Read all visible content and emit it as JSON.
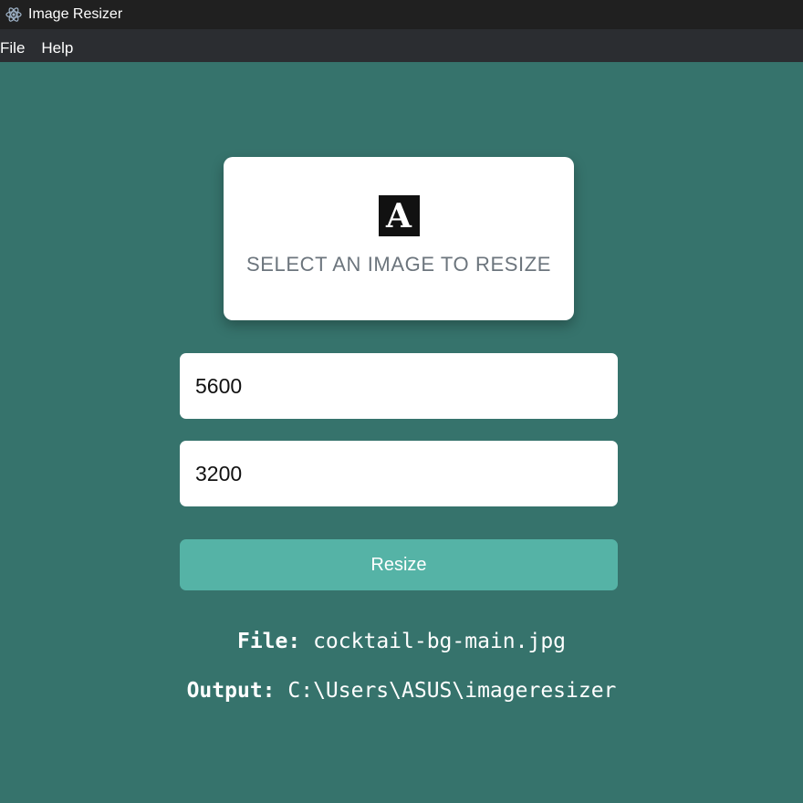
{
  "window": {
    "title": "Image Resizer",
    "icon": "electron-atom-icon"
  },
  "menu": {
    "items": [
      "File",
      "Help"
    ]
  },
  "select_card": {
    "logo_letter": "A",
    "label": "SELECT AN IMAGE TO RESIZE"
  },
  "form": {
    "width_value": "5600",
    "height_value": "3200",
    "resize_label": "Resize"
  },
  "info": {
    "file_label": "File:",
    "file_value": "cocktail-bg-main.jpg",
    "output_label": "Output:",
    "output_value": "C:\\Users\\ASUS\\imageresizer"
  },
  "colors": {
    "background": "#36736c",
    "button": "#55b3a6",
    "titlebar": "#202020",
    "menubar": "#2b2d31"
  }
}
